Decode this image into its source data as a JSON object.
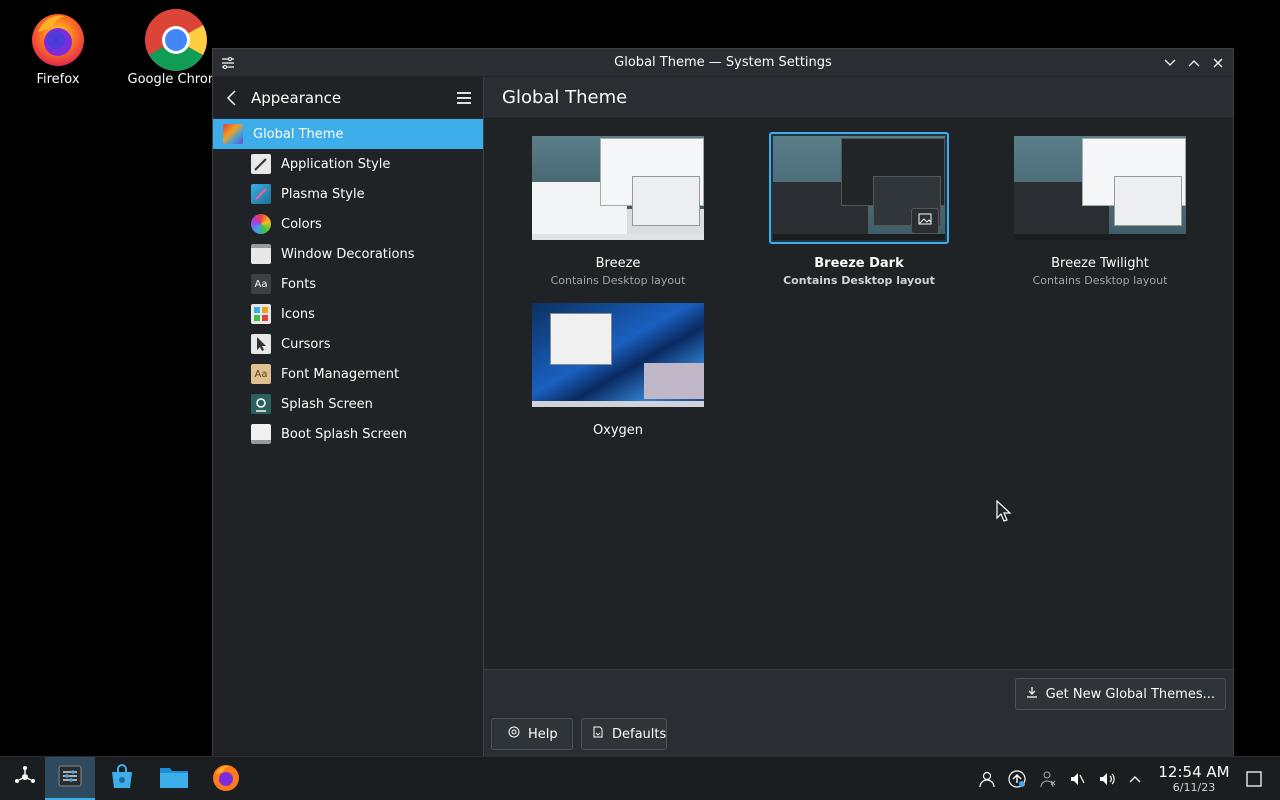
{
  "desktop": {
    "icons": [
      {
        "label": "Firefox"
      },
      {
        "label": "Google Chrom"
      }
    ]
  },
  "window": {
    "title": "Global Theme — System Settings"
  },
  "sidebar": {
    "header": "Appearance",
    "items": [
      {
        "label": "Global Theme",
        "icon": "global-theme-icon",
        "active": true
      },
      {
        "label": "Application Style",
        "icon": "application-style-icon"
      },
      {
        "label": "Plasma Style",
        "icon": "plasma-style-icon"
      },
      {
        "label": "Colors",
        "icon": "colors-icon"
      },
      {
        "label": "Window Decorations",
        "icon": "window-decorations-icon"
      },
      {
        "label": "Fonts",
        "icon": "fonts-icon"
      },
      {
        "label": "Icons",
        "icon": "icons-icon"
      },
      {
        "label": "Cursors",
        "icon": "cursors-icon"
      },
      {
        "label": "Font Management",
        "icon": "font-management-icon"
      },
      {
        "label": "Splash Screen",
        "icon": "splash-screen-icon"
      },
      {
        "label": "Boot Splash Screen",
        "icon": "boot-splash-icon"
      }
    ]
  },
  "main": {
    "title": "Global Theme",
    "themes": [
      {
        "name": "Breeze",
        "sub": "Contains Desktop layout"
      },
      {
        "name": "Breeze Dark",
        "sub": "Contains Desktop layout",
        "selected": true
      },
      {
        "name": "Breeze Twilight",
        "sub": "Contains Desktop layout"
      },
      {
        "name": "Oxygen",
        "sub": ""
      }
    ],
    "get_new_label": "Get New Global Themes...",
    "help_label": "Help",
    "defaults_label": "Defaults"
  },
  "taskbar": {
    "time": "12:54 AM",
    "date": "6/11/23"
  },
  "colors": {
    "accent": "#3daee9",
    "window_bg": "#2a2e32",
    "view_bg": "#202326"
  }
}
